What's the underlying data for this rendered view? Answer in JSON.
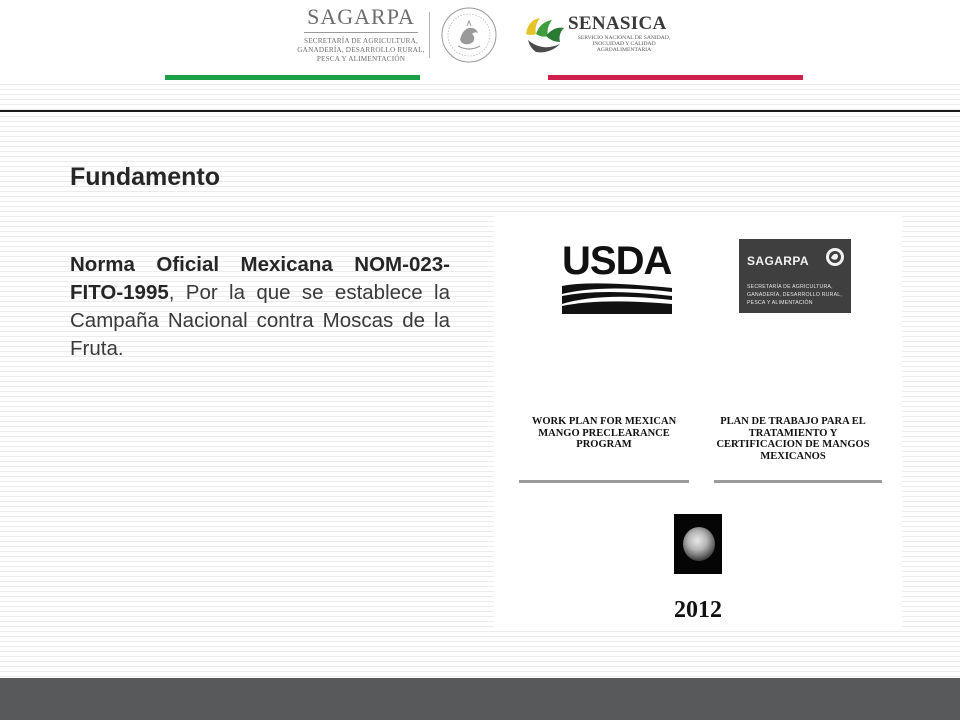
{
  "header": {
    "sagarpa": {
      "name": "SAGARPA",
      "subtitle_lines": [
        "SECRETARÍA DE AGRICULTURA,",
        "GANADERÍA, DESARROLLO RURAL,",
        "PESCA Y ALIMENTACIÓN"
      ]
    },
    "senasica": {
      "name": "SENASICA",
      "subtitle_lines": [
        "SERVICIO NACIONAL DE SANIDAD,",
        "INOCUIDAD Y CALIDAD",
        "AGROALIMENTARIA"
      ]
    },
    "bar_colors": {
      "green": "#1a9e46",
      "red": "#cf1f4c"
    }
  },
  "slide": {
    "title": "Fundamento",
    "body_bold": "Norma Oficial Mexicana NOM-023-FITO-1995",
    "body_rest": ", Por la que se establece la Campaña Nacional contra Moscas de la Fruta."
  },
  "document": {
    "usda_logo_text": "USDA",
    "sagarpa_box": {
      "name": "SAGARPA",
      "subtitle_lines": [
        "SECRETARÍA DE AGRICULTURA,",
        "GANADERÍA, DESARROLLO RURAL,",
        "PESCA Y ALIMENTACIÓN"
      ]
    },
    "english_title": "WORK PLAN FOR MEXICAN MANGO PRECLEARANCE PROGRAM",
    "spanish_title": "PLAN DE TRABAJO PARA EL TRATAMIENTO Y CERTIFICACION DE MANGOS MEXICANOS",
    "year": "2012"
  },
  "colors": {
    "footer": "#58595b"
  }
}
